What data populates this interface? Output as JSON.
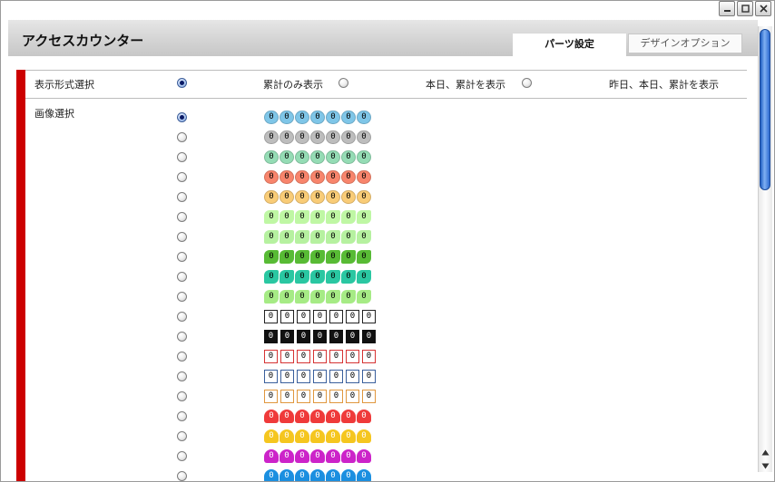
{
  "window": {
    "controls": [
      {
        "name": "minimize-button",
        "icon": "minimize-icon"
      },
      {
        "name": "maximize-button",
        "icon": "maximize-icon"
      },
      {
        "name": "close-button",
        "icon": "close-icon"
      }
    ]
  },
  "header": {
    "title": "アクセスカウンター",
    "tabs": [
      {
        "label": "パーツ設定",
        "active": true
      },
      {
        "label": "デザインオプション",
        "active": false
      }
    ]
  },
  "form": {
    "display_format_label": "表示形式選択",
    "display_options": [
      {
        "label": "累計のみ表示",
        "checked": false
      },
      {
        "label": "本日、累計を表示",
        "checked": false
      },
      {
        "label": "昨日、本日、累計を表示",
        "checked": false
      }
    ],
    "display_format_selected": true,
    "image_select_label": "画像選択",
    "digit_glyph": "0",
    "digits_per_counter": 7,
    "image_styles": [
      {
        "style": "pill",
        "color": "#7fc6e8",
        "checked": true
      },
      {
        "style": "pill",
        "color": "#bdbdbd",
        "checked": false
      },
      {
        "style": "pill",
        "color": "#95dcb5",
        "checked": false
      },
      {
        "style": "pill",
        "color": "#f8856c",
        "checked": false
      },
      {
        "style": "pill",
        "color": "#f9cc77",
        "checked": false
      },
      {
        "style": "flower",
        "color": "#bff7a4",
        "checked": false
      },
      {
        "style": "flower",
        "color": "#b6f1a0",
        "checked": false
      },
      {
        "style": "flower",
        "color": "#58bb35",
        "checked": false
      },
      {
        "style": "flower",
        "color": "#2ac7a2",
        "checked": false
      },
      {
        "style": "flower",
        "color": "#a6eb85",
        "checked": false
      },
      {
        "style": "box-outline",
        "color": "#222222",
        "checked": false
      },
      {
        "style": "box-filled",
        "color": "#111111",
        "checked": false
      },
      {
        "style": "box-outline",
        "color": "#d63333",
        "checked": false
      },
      {
        "style": "box-outline",
        "color": "#3a5f9c",
        "checked": false
      },
      {
        "style": "box-outline",
        "color": "#e0973e",
        "checked": false
      },
      {
        "style": "heart",
        "color": "#ef3a3a",
        "checked": false
      },
      {
        "style": "heart",
        "color": "#f5c61f",
        "checked": false
      },
      {
        "style": "heart",
        "color": "#cc23c9",
        "checked": false
      },
      {
        "style": "heart",
        "color": "#1b8fe0",
        "checked": false
      }
    ]
  }
}
